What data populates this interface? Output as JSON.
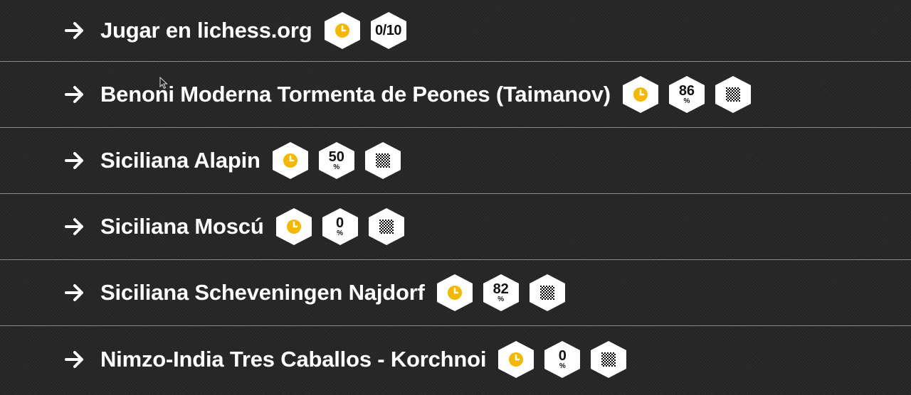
{
  "colors": {
    "background": "#262626",
    "divider": "#8a8a8a",
    "text": "#ffffff",
    "badge_bg": "#ffffff",
    "clock_accent": "#f5b800",
    "badge_text": "#111111"
  },
  "icons": {
    "arrow": "arrow-right-icon",
    "clock": "clock-icon",
    "board": "chessboard-icon",
    "cursor": "mouse-cursor-icon"
  },
  "items": [
    {
      "title": "Jugar en lichess.org",
      "count": "0/10"
    },
    {
      "title": "Benoni Moderna Tormenta de Peones (Taimanov)",
      "percent": "86",
      "percent_sign": "%"
    },
    {
      "title": "Siciliana Alapin",
      "percent": "50",
      "percent_sign": "%"
    },
    {
      "title": "Siciliana Moscú",
      "percent": "0",
      "percent_sign": "%"
    },
    {
      "title": "Siciliana Scheveningen Najdorf",
      "percent": "82",
      "percent_sign": "%"
    },
    {
      "title": "Nimzo-India Tres Caballos - Korchnoi",
      "percent": "0",
      "percent_sign": "%"
    }
  ]
}
